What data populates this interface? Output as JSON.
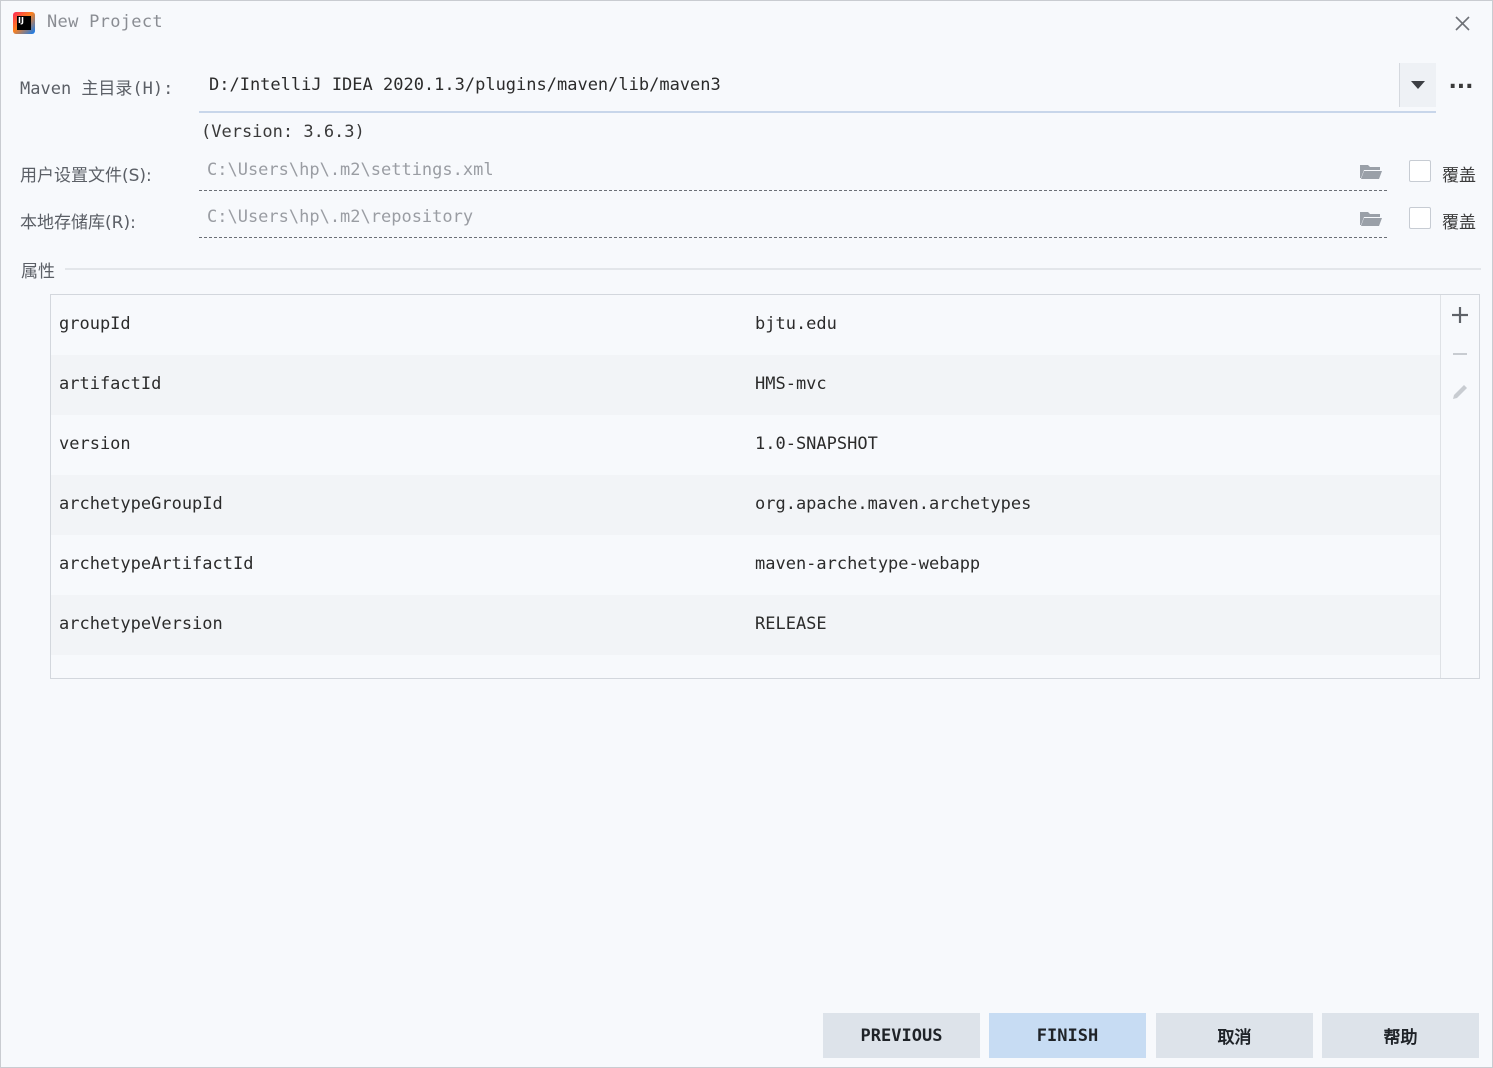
{
  "window": {
    "title": "New Project",
    "app_icon_text": "IJ"
  },
  "maven_home": {
    "label": "Maven 主目录(H):",
    "value": "D:/IntelliJ IDEA 2020.1.3/plugins/maven/lib/maven3",
    "more_label": "...",
    "version_text": "(Version: 3.6.3)"
  },
  "user_settings": {
    "label": "用户设置文件(S):",
    "value": "C:\\Users\\hp\\.m2\\settings.xml",
    "override_label": "覆盖",
    "override_checked": false
  },
  "local_repo": {
    "label": "本地存储库(R):",
    "value": "C:\\Users\\hp\\.m2\\repository",
    "override_label": "覆盖",
    "override_checked": false
  },
  "properties": {
    "section_label": "属性",
    "rows": [
      {
        "key": "groupId",
        "value": "bjtu.edu"
      },
      {
        "key": "artifactId",
        "value": "HMS-mvc"
      },
      {
        "key": "version",
        "value": "1.0-SNAPSHOT"
      },
      {
        "key": "archetypeGroupId",
        "value": "org.apache.maven.archetypes"
      },
      {
        "key": "archetypeArtifactId",
        "value": "maven-archetype-webapp"
      },
      {
        "key": "archetypeVersion",
        "value": "RELEASE"
      }
    ]
  },
  "buttons": {
    "previous": "PREVIOUS",
    "finish": "FINISH",
    "cancel": "取消",
    "help": "帮助"
  },
  "colors": {
    "background": "#f7f9fc",
    "primary_button": "#c7dcf3",
    "secondary_button": "#dde3ea",
    "focus_underline": "#c8d6ea"
  }
}
